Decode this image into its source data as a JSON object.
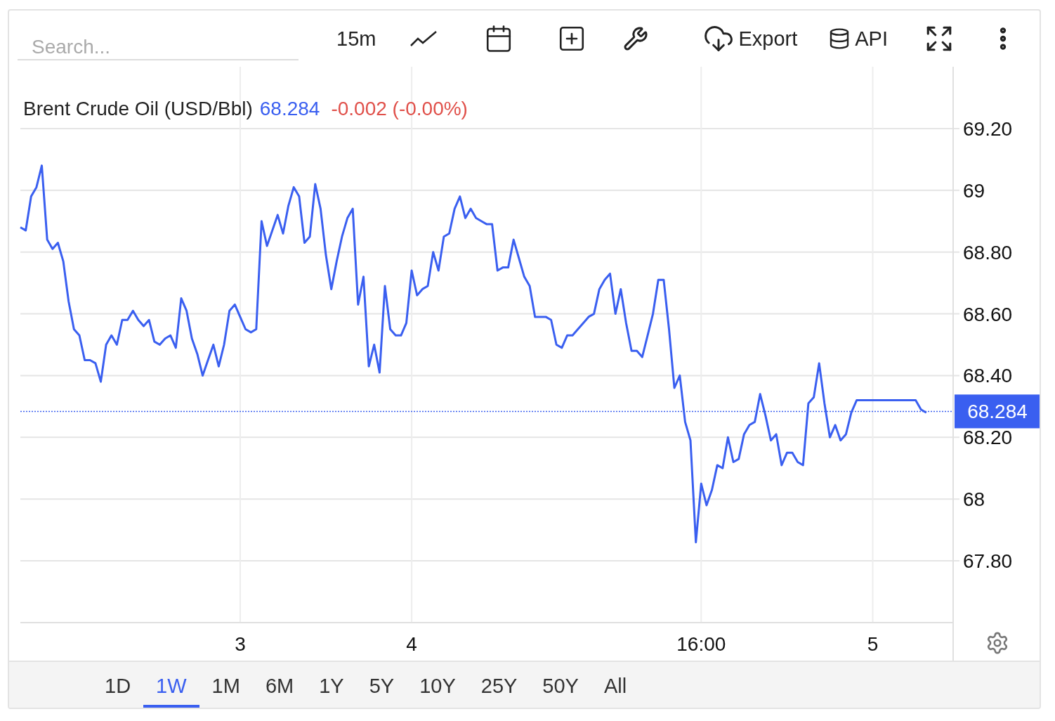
{
  "search": {
    "placeholder": "Search..."
  },
  "toolbar": {
    "interval": "15m",
    "export": "Export",
    "api": "API"
  },
  "legend": {
    "price": "68.284",
    "change": "-0.002 (-0.00%)"
  },
  "chart_data": {
    "type": "line",
    "grid": true,
    "ylim": [
      67.6,
      69.4
    ],
    "categories": [
      null,
      null,
      null,
      null,
      null,
      null,
      null,
      null,
      null,
      null,
      null,
      null,
      null,
      null,
      null,
      null,
      null,
      null,
      null,
      null,
      null,
      null,
      null,
      null,
      null,
      null,
      null,
      null,
      null,
      null,
      null,
      null,
      null,
      null,
      null,
      null,
      null,
      null,
      null,
      null,
      null,
      "3",
      null,
      null,
      null,
      null,
      null,
      null,
      null,
      null,
      null,
      null,
      null,
      null,
      null,
      null,
      null,
      null,
      null,
      null,
      null,
      null,
      null,
      null,
      null,
      null,
      null,
      null,
      null,
      null,
      null,
      null,
      null,
      "4",
      null,
      null,
      null,
      null,
      null,
      null,
      null,
      null,
      null,
      null,
      null,
      null,
      null,
      null,
      null,
      null,
      null,
      null,
      null,
      null,
      null,
      null,
      null,
      null,
      null,
      null,
      null,
      null,
      null,
      null,
      null,
      null,
      null,
      null,
      null,
      null,
      null,
      null,
      null,
      null,
      null,
      null,
      null,
      null,
      null,
      null,
      null,
      null,
      null,
      null,
      null,
      null,
      null,
      "16:00",
      null,
      null,
      null,
      null,
      null,
      null,
      null,
      null,
      null,
      null,
      null,
      null,
      null,
      null,
      null,
      null,
      null,
      null,
      null,
      null,
      null,
      null,
      null,
      null,
      null,
      null,
      null,
      null,
      null,
      null,
      null,
      "5",
      null,
      null,
      null,
      null,
      null,
      null,
      null,
      null,
      null,
      null
    ],
    "yticks": [
      {
        "value": 67.8,
        "label": "67.80"
      },
      {
        "value": 68,
        "label": "68"
      },
      {
        "value": 68.2,
        "label": "68.20"
      },
      {
        "value": 68.4,
        "label": "68.40"
      },
      {
        "value": 68.6,
        "label": "68.60"
      },
      {
        "value": 68.8,
        "label": "68.80"
      },
      {
        "value": 69,
        "label": "69"
      },
      {
        "value": 69.2,
        "label": "69.20"
      }
    ],
    "series": [
      {
        "name": "Brent Crude Oil (USD/Bbl)",
        "color": "#3a5ff0",
        "values": [
          68.88,
          68.87,
          68.98,
          69.01,
          69.08,
          68.84,
          68.81,
          68.83,
          68.77,
          68.64,
          68.55,
          68.53,
          68.45,
          68.45,
          68.44,
          68.38,
          68.5,
          68.53,
          68.5,
          68.58,
          68.58,
          68.61,
          68.58,
          68.56,
          68.58,
          68.51,
          68.5,
          68.52,
          68.53,
          68.49,
          68.65,
          68.61,
          68.52,
          68.47,
          68.4,
          68.45,
          68.5,
          68.43,
          68.5,
          68.61,
          68.63,
          68.59,
          68.55,
          68.54,
          68.55,
          68.9,
          68.82,
          68.87,
          68.92,
          68.86,
          68.95,
          69.01,
          68.98,
          68.83,
          68.85,
          69.02,
          68.94,
          68.79,
          68.68,
          68.77,
          68.85,
          68.91,
          68.94,
          68.63,
          68.72,
          68.43,
          68.5,
          68.41,
          68.69,
          68.55,
          68.53,
          68.53,
          68.57,
          68.74,
          68.66,
          68.68,
          68.69,
          68.8,
          68.74,
          68.85,
          68.86,
          68.94,
          68.98,
          68.91,
          68.94,
          68.91,
          68.9,
          68.89,
          68.89,
          68.74,
          68.75,
          68.75,
          68.84,
          68.78,
          68.72,
          68.69,
          68.59,
          68.59,
          68.59,
          68.58,
          68.5,
          68.49,
          68.53,
          68.53,
          68.55,
          68.57,
          68.59,
          68.6,
          68.68,
          68.71,
          68.73,
          68.6,
          68.68,
          68.57,
          68.48,
          68.48,
          68.46,
          68.53,
          68.6,
          68.71,
          68.71,
          68.55,
          68.36,
          68.4,
          68.25,
          68.19,
          67.86,
          68.05,
          67.98,
          68.03,
          68.11,
          68.1,
          68.2,
          68.12,
          68.13,
          68.21,
          68.24,
          68.25,
          68.34,
          68.27,
          68.19,
          68.21,
          68.11,
          68.15,
          68.15,
          68.12,
          68.11,
          68.31,
          68.33,
          68.44,
          68.31,
          68.2,
          68.24,
          68.19,
          68.21,
          68.28,
          68.32,
          68.32,
          68.32,
          68.32,
          68.32,
          68.32,
          68.32,
          68.32,
          68.32,
          68.32,
          68.32,
          68.32,
          68.29,
          68.28
        ]
      }
    ],
    "ref_lines": [
      {
        "axis": "y",
        "value": 68.284,
        "label": "68.284"
      }
    ]
  },
  "ranges": [
    {
      "label": "1D",
      "selected": false
    },
    {
      "label": "1W",
      "selected": true
    },
    {
      "label": "1M",
      "selected": false
    },
    {
      "label": "6M",
      "selected": false
    },
    {
      "label": "1Y",
      "selected": false
    },
    {
      "label": "5Y",
      "selected": false
    },
    {
      "label": "10Y",
      "selected": false
    },
    {
      "label": "25Y",
      "selected": false
    },
    {
      "label": "50Y",
      "selected": false
    },
    {
      "label": "All",
      "selected": false
    }
  ]
}
